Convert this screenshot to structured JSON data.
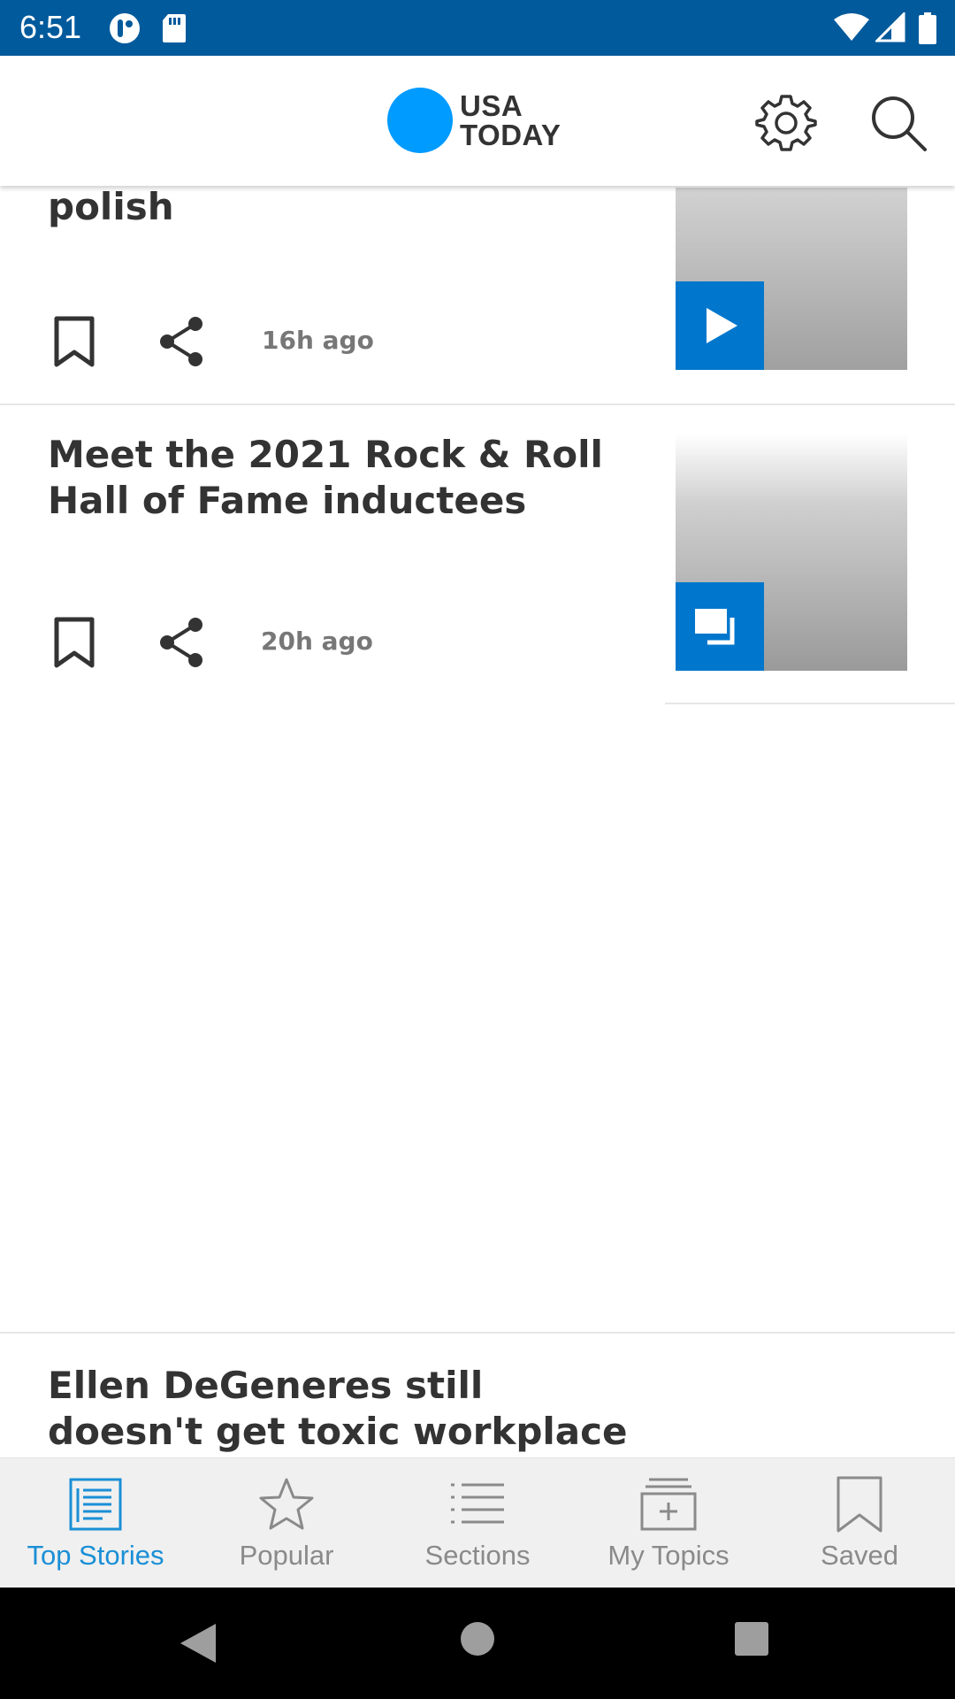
{
  "status_bar": {
    "time": "6:51",
    "icons": [
      "data-saver-icon",
      "sd-card-icon",
      "wifi-icon",
      "signal-icon",
      "battery-icon"
    ]
  },
  "header": {
    "logo_line1": "USA",
    "logo_line2": "TODAY",
    "logo_color": "#009bff",
    "settings_icon": "gear-icon",
    "search_icon": "search-icon"
  },
  "stories": [
    {
      "title": "polish",
      "time_ago": "16h ago",
      "media": "video"
    },
    {
      "title": "Meet the 2021 Rock & Roll Hall of Fame inductees",
      "time_ago": "20h ago",
      "media": "gallery"
    },
    {
      "title": "Ellen DeGeneres still doesn't get toxic workplace claims"
    }
  ],
  "bottom_nav": {
    "items": [
      {
        "label": "Top Stories",
        "icon": "newspaper-icon",
        "active": true
      },
      {
        "label": "Popular",
        "icon": "star-icon",
        "active": false
      },
      {
        "label": "Sections",
        "icon": "list-icon",
        "active": false
      },
      {
        "label": "My Topics",
        "icon": "add-topic-icon",
        "active": false
      },
      {
        "label": "Saved",
        "icon": "bookmark-icon",
        "active": false
      }
    ],
    "active_color": "#1a8fd6",
    "inactive_color": "#8a8a8a"
  }
}
